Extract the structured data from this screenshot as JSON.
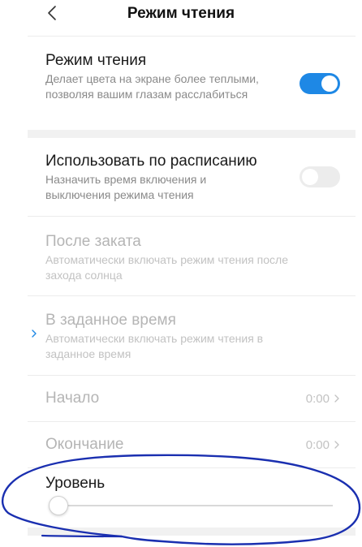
{
  "header": {
    "title": "Режим чтения"
  },
  "reading_mode": {
    "title": "Режим чтения",
    "description": "Делает цвета на экране более теплыми, позволяя вашим глазам расслабиться",
    "enabled": true
  },
  "schedule": {
    "title": "Использовать по расписанию",
    "description": "Назначить время включения и выключения режима чтения",
    "enabled": false
  },
  "after_sunset": {
    "title": "После заката",
    "description": "Автоматически включать режим чтения после захода солнца"
  },
  "custom_time": {
    "title": "В заданное время",
    "description": "Автоматически включать режим чтения в заданное время"
  },
  "start": {
    "label": "Начало",
    "value": "0:00"
  },
  "end": {
    "label": "Окончание",
    "value": "0:00"
  },
  "level": {
    "label": "Уровень",
    "value": 0
  },
  "colors": {
    "accent": "#1e88e5",
    "annotation": "#1a2fb0"
  }
}
